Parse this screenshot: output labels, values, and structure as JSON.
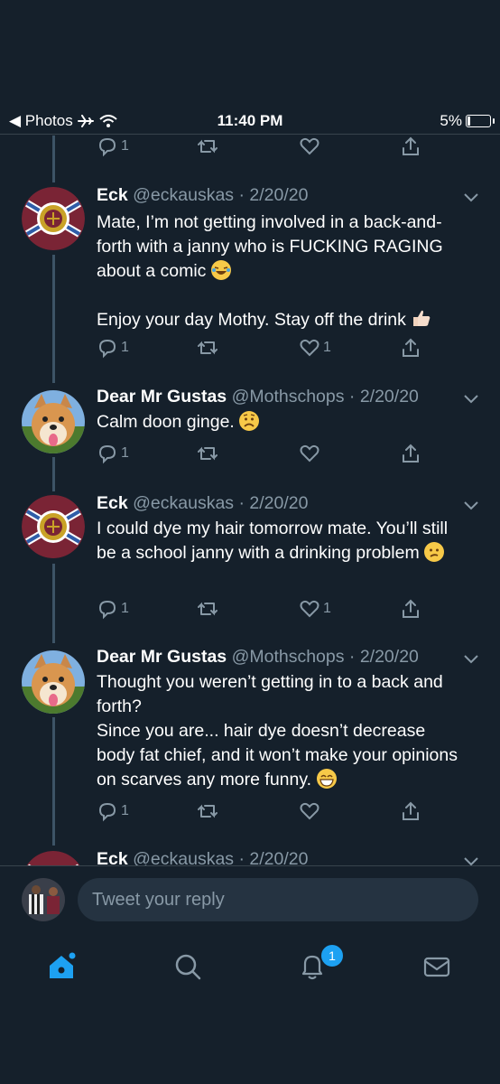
{
  "status_bar": {
    "back_label": "◀ Photos",
    "time": "11:40 PM",
    "battery": "5%"
  },
  "top_actions": {
    "reply_count": "1"
  },
  "tweets": [
    {
      "name": "Eck",
      "handle": "@eckauskas · 2/20/20",
      "text": "Mate, I’m not getting involved in a back-and-forth with a janny who is FUCKING RAGING about a comic",
      "text2": "Enjoy your day Mothy. Stay off the drink",
      "reply_count": "1",
      "like_count": "1",
      "avatar": "crest-avatar"
    },
    {
      "name": "Dear Mr Gustas",
      "handle": "@Mothschops · 2/20/20",
      "text": "Calm doon ginge.",
      "reply_count": "1",
      "like_count": "",
      "avatar": "dog-avatar"
    },
    {
      "name": "Eck",
      "handle": "@eckauskas · 2/20/20",
      "text": "I could dye my hair tomorrow mate. You’ll still be a school janny with a drinking problem",
      "reply_count": "1",
      "like_count": "1",
      "avatar": "crest-avatar"
    },
    {
      "name": "Dear Mr Gustas",
      "handle": "@Mothschops · 2/20/20",
      "text": "Thought you weren’t getting in to a back and forth?\nSince you are... hair dye doesn’t decrease body fat chief, and it won’t make your opinions on scarves any more funny.",
      "reply_count": "1",
      "like_count": "",
      "avatar": "dog-avatar"
    },
    {
      "name": "Eck",
      "handle": "@eckauskas · 2/20/20"
    }
  ],
  "reply": {
    "placeholder": "Tweet your reply"
  },
  "tabs": {
    "notifications_badge": "1"
  },
  "colors": {
    "background": "#15202b",
    "accent": "#1da1f2",
    "muted": "#8899a6",
    "crest": "#7a2435"
  }
}
